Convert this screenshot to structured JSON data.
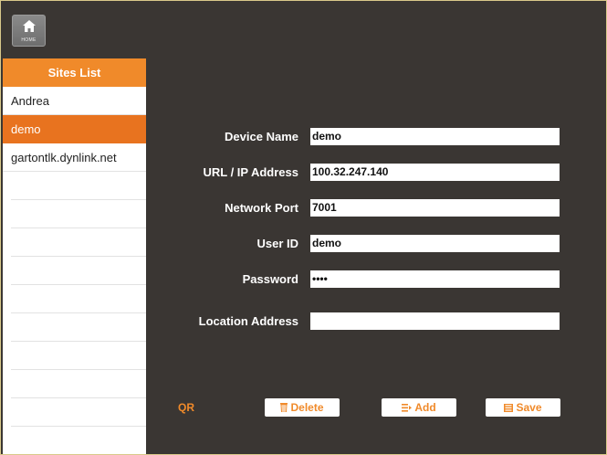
{
  "home": {
    "label": "HOME"
  },
  "sidebar": {
    "title": "Sites List",
    "sites": [
      {
        "label": "Andrea",
        "selected": false
      },
      {
        "label": "demo",
        "selected": true
      },
      {
        "label": "gartontlk.dynlink.net",
        "selected": false
      }
    ]
  },
  "form": {
    "device_name": {
      "label": "Device Name",
      "value": "demo"
    },
    "url": {
      "label": "URL / IP Address",
      "value": "100.32.247.140"
    },
    "port": {
      "label": "Network Port",
      "value": "7001"
    },
    "user_id": {
      "label": "User ID",
      "value": "demo"
    },
    "password": {
      "label": "Password",
      "value": "••••"
    },
    "location": {
      "label": "Location Address",
      "value": ""
    }
  },
  "actions": {
    "qr": "QR",
    "delete": "Delete",
    "add": "Add",
    "save": "Save"
  },
  "colors": {
    "accent": "#f08a2a",
    "selected_row": "#e8731f",
    "background": "#3a3633"
  }
}
